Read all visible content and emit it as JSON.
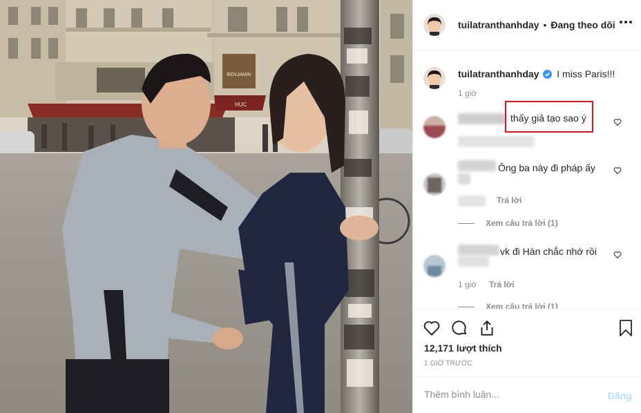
{
  "post": {
    "author": "tuilatranthanhday",
    "follow_status": "Đang theo dõi",
    "header_separator": "•",
    "caption": "I miss Paris!!!",
    "caption_time": "1 giờ"
  },
  "comments": [
    {
      "text": "thấy giả tạo sao ý",
      "highlighted": true
    },
    {
      "text": "Ông ba này đi pháp ấy",
      "reply_label": "Trả lời",
      "view_replies": "Xem câu trả lời (1)"
    },
    {
      "text": "vk đi Hàn chắc nhớ rồi",
      "time": "1 giờ",
      "reply_label": "Trả lời",
      "view_replies": "Xem câu trả lời (1)"
    }
  ],
  "actions": {
    "likes": "12,171 lượt thích",
    "timestamp": "1 GIỜ TRƯỚC",
    "comment_placeholder": "Thêm bình luận...",
    "post_label": "Đăng"
  },
  "photo_signs": {
    "awning": "HUC",
    "shop_sign": "BENJAMIN"
  },
  "colors": {
    "highlight_border": "#e0141e",
    "verified_badge": "#3897f0",
    "muted_text": "#8e8e8e",
    "post_button_disabled": "#b9dffc"
  },
  "icons": [
    "more-options-icon",
    "verified-badge-icon",
    "heart-icon",
    "comment-icon",
    "share-icon",
    "bookmark-icon"
  ]
}
